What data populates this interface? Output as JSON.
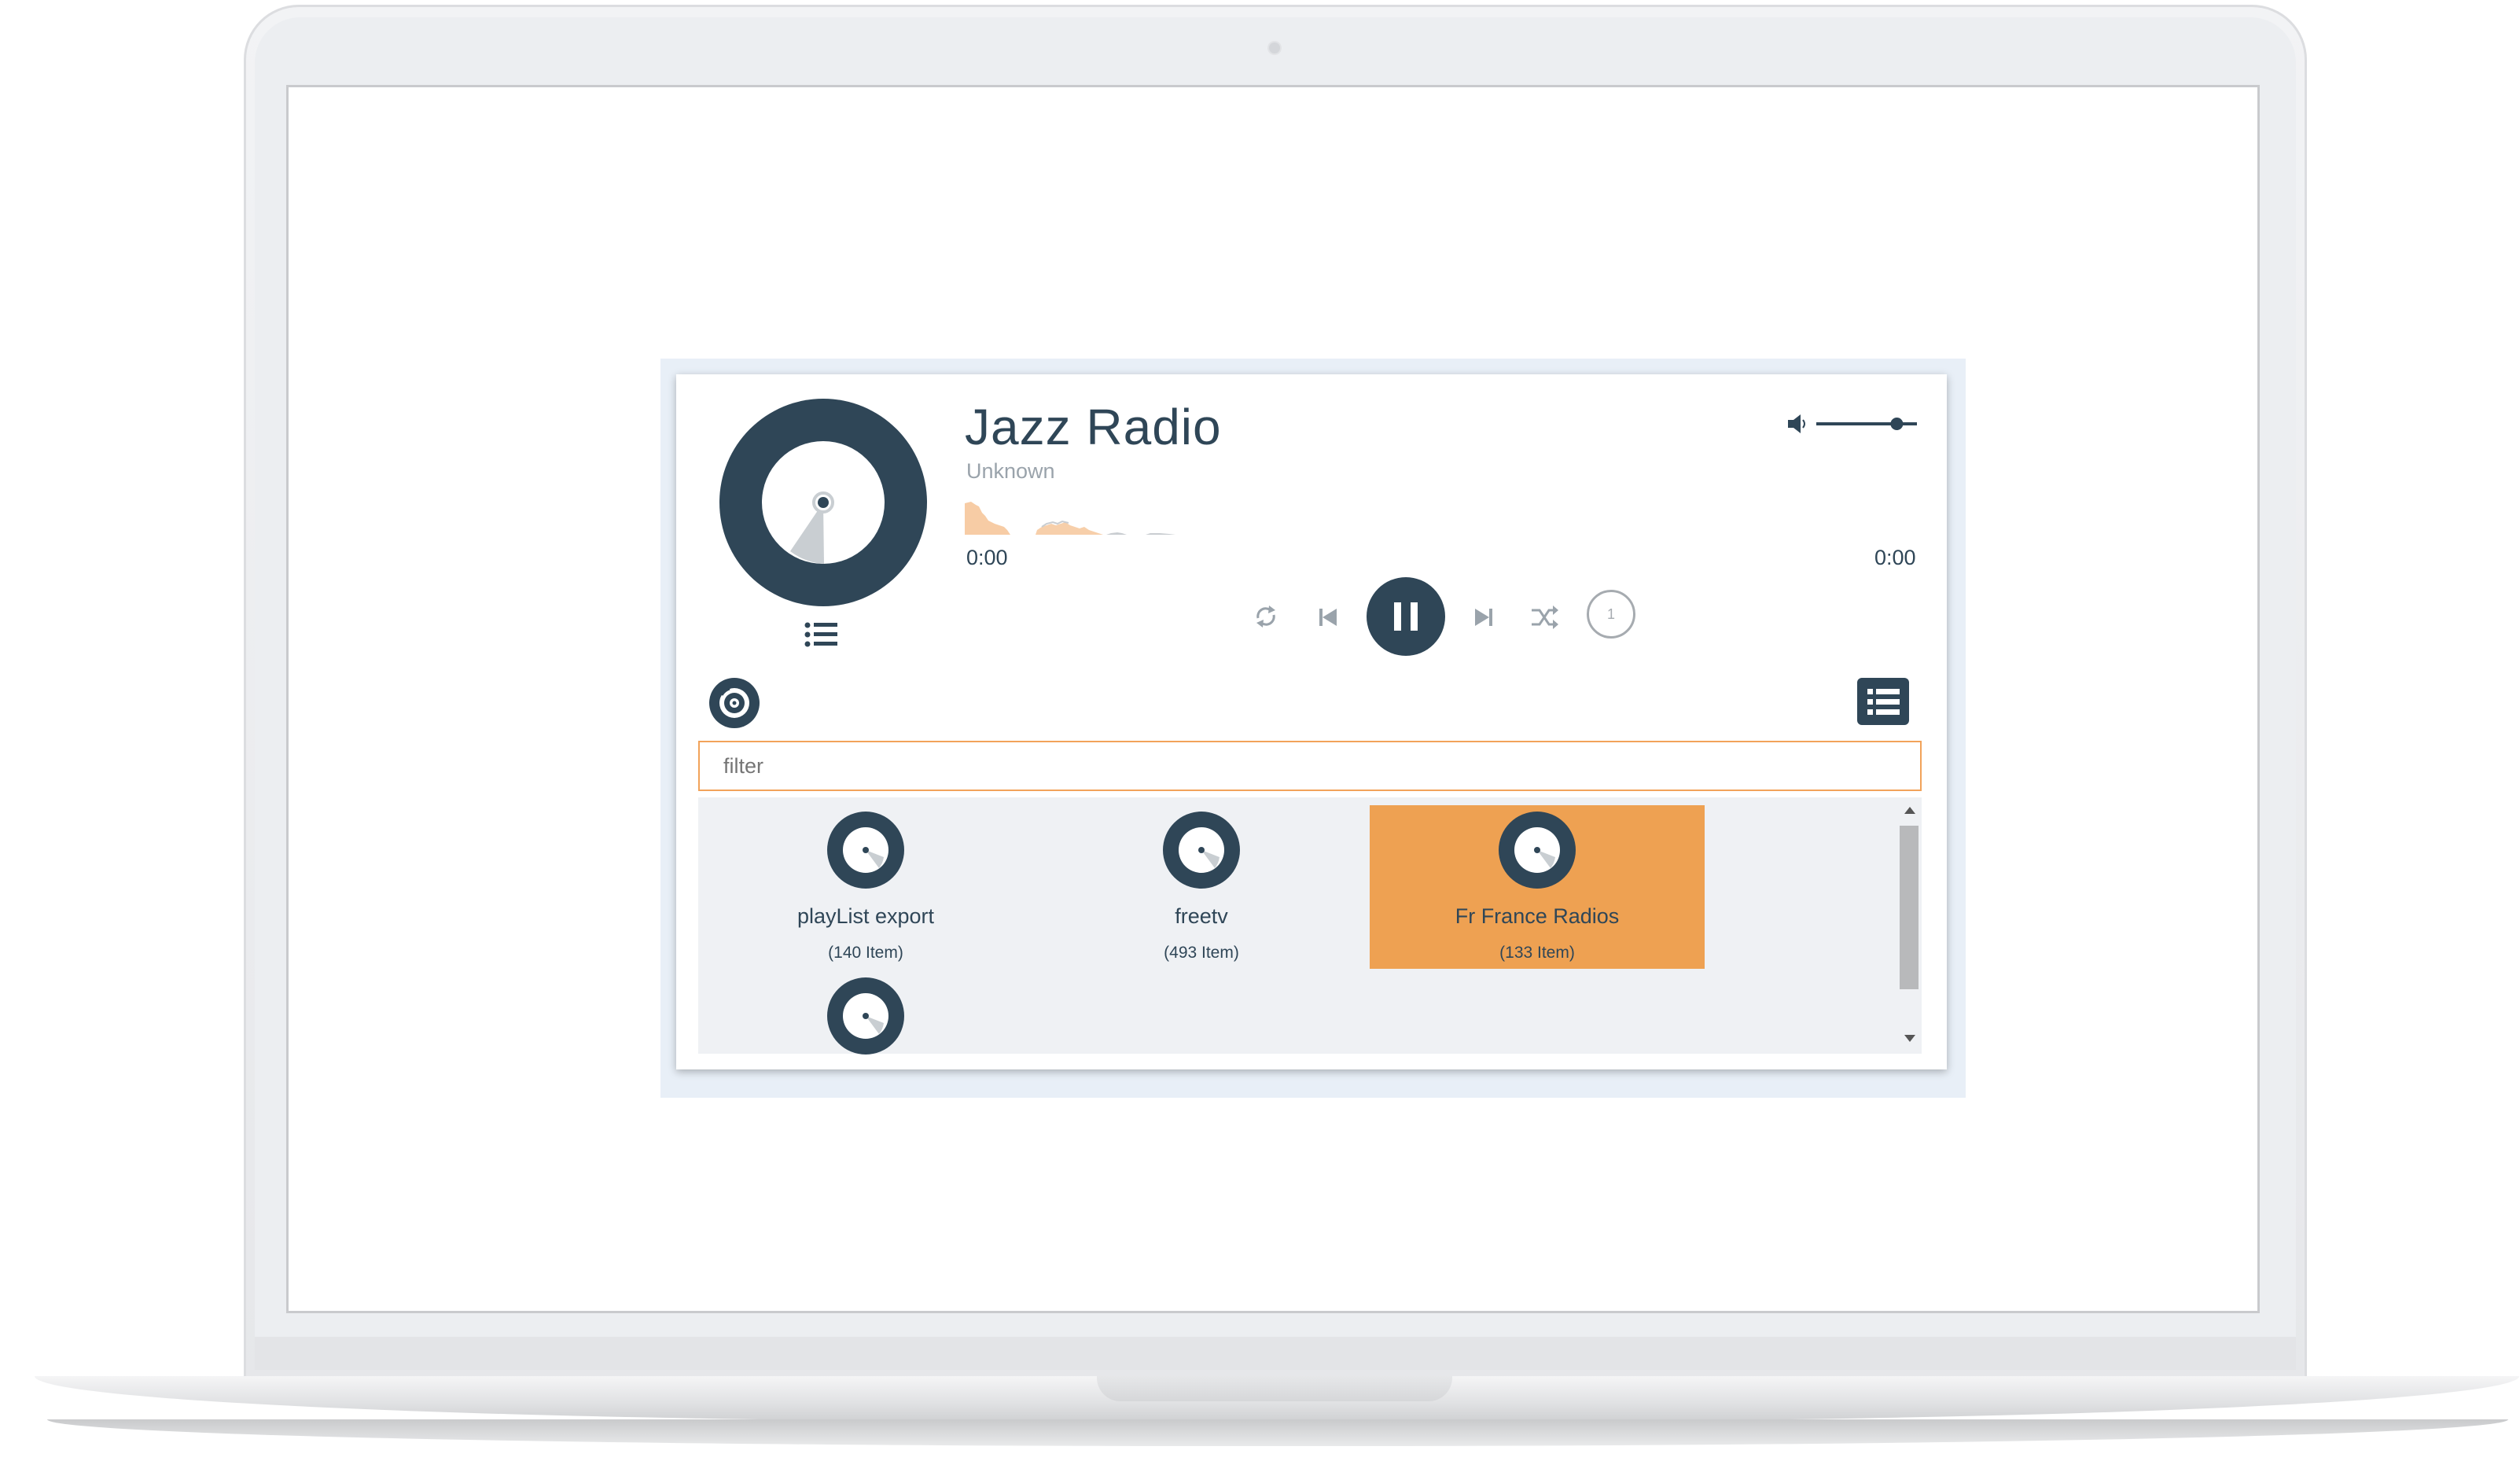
{
  "player": {
    "title": "Jazz Radio",
    "artist": "Unknown",
    "time_elapsed": "0:00",
    "time_total": "0:00",
    "queue_count": "1",
    "volume_level": 0.8
  },
  "filter": {
    "placeholder": "filter"
  },
  "playlists": [
    {
      "name": "playList export",
      "count": "(140 Item)",
      "selected": false
    },
    {
      "name": "freetv",
      "count": "(493 Item)",
      "selected": false
    },
    {
      "name": "Fr France Radios",
      "count": "(133 Item)",
      "selected": true
    }
  ],
  "colors": {
    "primary": "#2f4657",
    "accent": "#eea152",
    "filter_border": "#f2a35a",
    "muted": "#9aa3ab",
    "grid_bg": "#eff1f4"
  },
  "icons": {
    "album_disc": "disc-icon",
    "list_toggle": "list-icon",
    "volume": "speaker-icon",
    "repeat": "repeat-icon",
    "previous": "skip-previous-icon",
    "pause": "pause-icon",
    "next": "skip-next-icon",
    "shuffle": "shuffle-icon",
    "playlist_menu": "playlist-icon",
    "small_disc": "cd-icon"
  }
}
